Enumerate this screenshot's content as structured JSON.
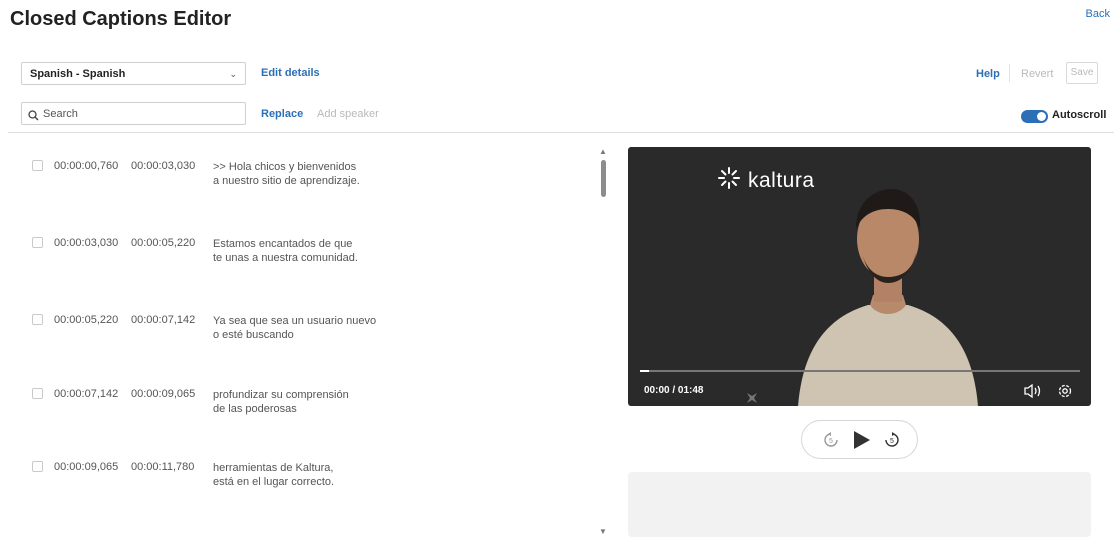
{
  "header": {
    "title": "Closed Captions Editor",
    "back_label": "Back"
  },
  "toolbar": {
    "language": "Spanish - Spanish",
    "edit_details": "Edit details",
    "help": "Help",
    "revert": "Revert",
    "save": "Save",
    "search_placeholder": "Search",
    "replace": "Replace",
    "add_speaker": "Add speaker",
    "autoscroll": "Autoscroll",
    "autoscroll_on": true
  },
  "captions": [
    {
      "start": "00:00:00,760",
      "end": "00:00:03,030",
      "line1": ">> Hola chicos y bienvenidos",
      "line2": "a nuestro sitio de aprendizaje."
    },
    {
      "start": "00:00:03,030",
      "end": "00:00:05,220",
      "line1": "Estamos encantados de que",
      "line2": "te unas a nuestra comunidad."
    },
    {
      "start": "00:00:05,220",
      "end": "00:00:07,142",
      "line1": "Ya sea que sea un usuario nuevo",
      "line2": "o esté buscando"
    },
    {
      "start": "00:00:07,142",
      "end": "00:00:09,065",
      "line1": "profundizar su comprensión",
      "line2": "de las poderosas"
    },
    {
      "start": "00:00:09,065",
      "end": "00:00:11,780",
      "line1": "herramientas de Kaltura,",
      "line2": "está en el lugar correcto."
    }
  ],
  "player": {
    "logo_text": "kaltura",
    "time": "00:00 / 01:48",
    "progress": 0.02,
    "skip_back_label": "5",
    "skip_fwd_label": "5"
  },
  "colors": {
    "accent": "#2c6fb7",
    "video_bg": "#2a2a2a",
    "panel_bg": "#f2f2f2"
  },
  "icons": {
    "search": "search-icon",
    "dropdown": "chevron-down-icon",
    "logo": "kaltura-logo-icon",
    "volume": "volume-icon",
    "settings": "gear-icon",
    "rewind": "rewind-5-icon",
    "play": "play-icon",
    "forward": "forward-5-icon"
  }
}
